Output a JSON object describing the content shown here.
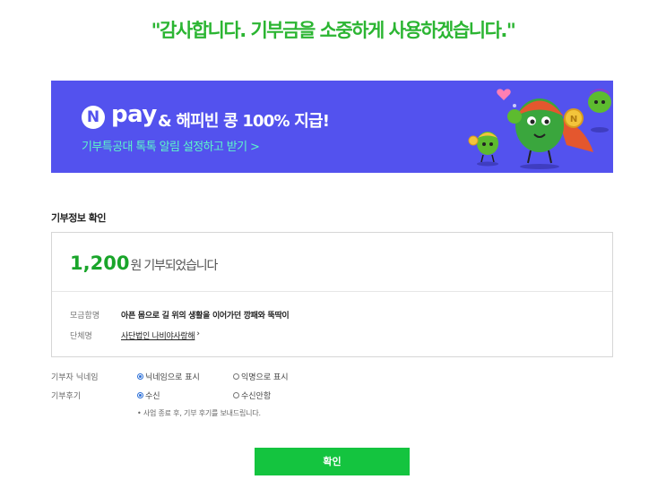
{
  "headline": "\"감사합니다. 기부금을 소중하게 사용하겠습니다.\"",
  "banner": {
    "logo_letter": "N",
    "logo_word": "pay",
    "title": "& 해피빈 콩 100% 지급!",
    "subtitle": "기부특공대 톡톡 알림 설정하고 받기 >",
    "background_color": "#5352ee",
    "subtitle_color": "#5df7c9"
  },
  "donation_info": {
    "section_title": "기부정보 확인",
    "amount": "1,200",
    "amount_suffix": "원 기부되었습니다",
    "rows": [
      {
        "label": "모금함명",
        "value": "아픈 몸으로 길 위의 생활을 이어가던 깡패와 뚝딱이"
      },
      {
        "label": "단체명",
        "value": "사단법인 나비야사랑해",
        "suffix": "›"
      }
    ]
  },
  "options": {
    "nickname": {
      "label": "기부자 닉네임",
      "choices": [
        {
          "text": "닉네임으로 표시",
          "selected": true
        },
        {
          "text": "익명으로 표시",
          "selected": false
        }
      ]
    },
    "review": {
      "label": "기부후기",
      "choices": [
        {
          "text": "수신",
          "selected": true
        },
        {
          "text": "수신안함",
          "selected": false
        }
      ]
    },
    "note": "• 사업 종료 후, 기부 후기를 보내드립니다."
  },
  "confirm_label": "확인",
  "accent_color": "#14c43f"
}
